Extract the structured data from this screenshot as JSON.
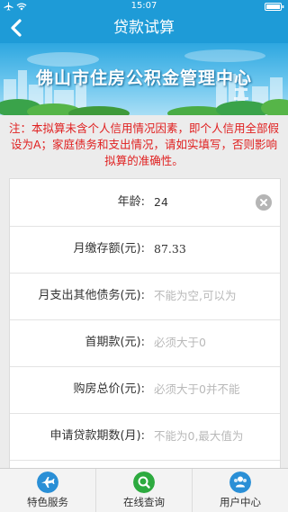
{
  "status_bar": {
    "time": "15:07"
  },
  "nav": {
    "title": "贷款试算",
    "back_icon": "chevron-left-icon"
  },
  "banner": {
    "title": "佛山市住房公积金管理中心"
  },
  "notice": {
    "text": "注：本拟算未含个人信用情况因素，即个人信用全部假设为A；家庭债务和支出情况，请如实填写，否则影响拟算的准确性。"
  },
  "form": {
    "rows": [
      {
        "label": "年龄:",
        "value": "24",
        "placeholder": ""
      },
      {
        "label": "月缴存额(元):",
        "value": "87.33",
        "placeholder": ""
      },
      {
        "label": "月支出其他债务(元):",
        "value": "",
        "placeholder": "不能为空,可以为"
      },
      {
        "label": "首期款(元):",
        "value": "",
        "placeholder": "必须大于0"
      },
      {
        "label": "购房总价(元):",
        "value": "",
        "placeholder": "必须大于0并不能"
      },
      {
        "label": "申请贷款期数(月):",
        "value": "",
        "placeholder": "不能为0,最大值为"
      }
    ]
  },
  "tabbar": {
    "items": [
      {
        "label": "特色服务",
        "icon": "plane-icon",
        "color": "#2a8fd6"
      },
      {
        "label": "在线查询",
        "icon": "search-icon",
        "color": "#2daa3f"
      },
      {
        "label": "用户中心",
        "icon": "user-group-icon",
        "color": "#2a8fd6"
      }
    ]
  },
  "colors": {
    "accent": "#1e9bd7",
    "warning_text": "#e02020"
  }
}
